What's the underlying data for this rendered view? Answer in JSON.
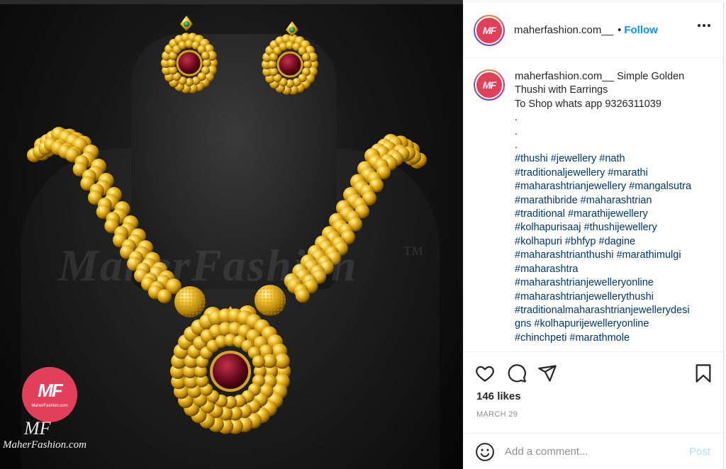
{
  "photo": {
    "watermark": "MaherFashion",
    "watermark_tm": "™",
    "logo_mark": "MF",
    "logo_site": "MaherFashion.com",
    "brand_script": "MF",
    "brand_domain": "MaherFashion.com"
  },
  "post": {
    "header": {
      "username": "maherfashion.com__",
      "separator": "•",
      "follow_label": "Follow"
    },
    "avatar_text": "MF",
    "caption": {
      "username": "maherfashion.com__",
      "first_text": "Simple Golden",
      "lines": [
        "Thushi with Earrings",
        "To Shop whats app 9326311039",
        ".",
        ".",
        "."
      ],
      "hashtag_lines": [
        "#thushi #jewellery #nath",
        "#traditionaljewellery #marathi",
        "#maharashtrianjewellery #mangalsutra",
        "#marathibride #maharashtrian",
        "#traditional #marathijewellery",
        "#kolhapurisaaj #thushijewellery",
        "#kolhapuri #bhfyp #dagine",
        "#maharashtrianthushi #marathimulgi",
        "#maharashtra",
        "#maharashtrianjewelleryonline",
        "#maharashtrianjewellerythushi",
        "#traditionalmaharashtrianjewellerydesi",
        "gns #kolhapurijewelleryonline",
        "#chinchpeti #marathmole"
      ]
    },
    "likes": "146 likes",
    "date": "MARCH 29",
    "comment_placeholder": "Add a comment...",
    "post_label": "Post",
    "icons": [
      "heart-icon",
      "comment-icon",
      "share-icon",
      "bookmark-icon",
      "emoji-icon",
      "more-icon"
    ]
  },
  "colors": {
    "accent_blue": "#0095f6",
    "hashtag": "#00376b",
    "brand_red": "#e2405a",
    "gold": "#d9a520"
  }
}
